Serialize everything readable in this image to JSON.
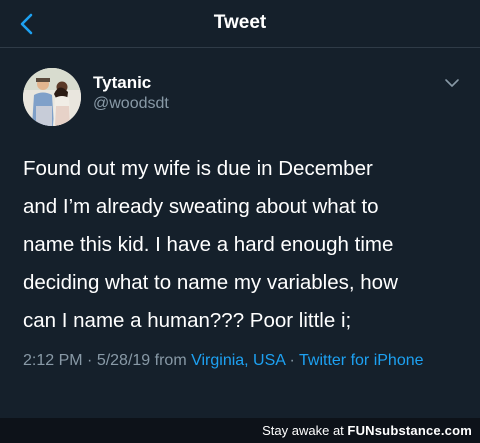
{
  "colors": {
    "background": "#15202b",
    "accent": "#1da1f2",
    "secondary_text": "#8899a6"
  },
  "header": {
    "title": "Tweet",
    "back_icon": "chevron-left-icon"
  },
  "author": {
    "display_name": "Tytanic",
    "handle": "@woodsdt",
    "menu_icon": "chevron-down-icon"
  },
  "tweet": {
    "text": "Found out my wife is due in December\nand I’m already sweating about what to\nname this kid.  I have a hard enough time\ndeciding what to name my variables, how\ncan I name a human??? Poor little i;"
  },
  "meta": {
    "time": "2:12 PM",
    "separator": " · ",
    "date": "5/28/19",
    "from_label": " from ",
    "location": "Virginia, USA",
    "client": "Twitter for iPhone"
  },
  "footer": {
    "prefix": "Stay awake at ",
    "brand_fun": "FUN",
    "brand_rest": "substance.com"
  }
}
